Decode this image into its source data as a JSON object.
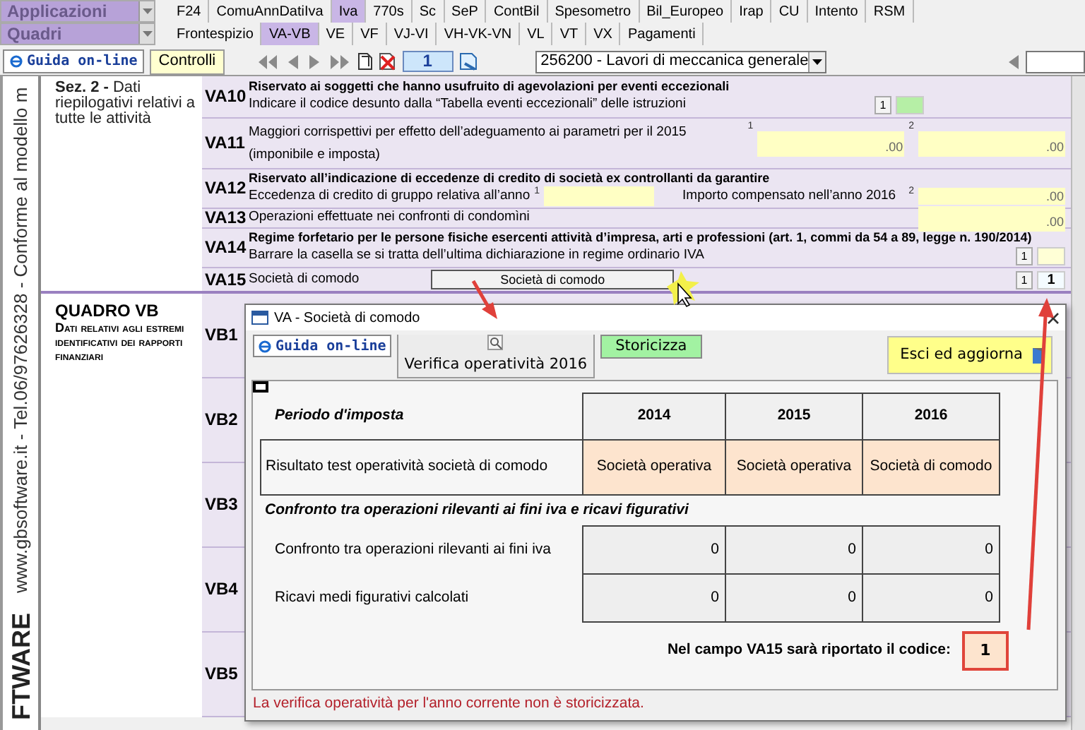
{
  "menus": [
    {
      "label": "Applicazioni",
      "tabs": [
        {
          "label": "F24",
          "selected": false
        },
        {
          "label": "ComuAnnDatiIva",
          "selected": false
        },
        {
          "label": "Iva",
          "selected": true
        },
        {
          "label": "770s",
          "selected": false
        },
        {
          "label": "Sc",
          "selected": false
        },
        {
          "label": "SeP",
          "selected": false
        },
        {
          "label": "ContBil",
          "selected": false
        },
        {
          "label": "Spesometro",
          "selected": false
        },
        {
          "label": "Bil_Europeo",
          "selected": false
        },
        {
          "label": "Irap",
          "selected": false
        },
        {
          "label": "CU",
          "selected": false
        },
        {
          "label": "Intento",
          "selected": false
        },
        {
          "label": "RSM",
          "selected": false
        }
      ]
    },
    {
      "label": "Quadri",
      "tabs": [
        {
          "label": "Frontespizio",
          "selected": false
        },
        {
          "label": "VA-VB",
          "selected": true
        },
        {
          "label": "VE",
          "selected": false
        },
        {
          "label": "VF",
          "selected": false
        },
        {
          "label": "VJ-VI",
          "selected": false
        },
        {
          "label": "VH-VK-VN",
          "selected": false
        },
        {
          "label": "VL",
          "selected": false
        },
        {
          "label": "VT",
          "selected": false
        },
        {
          "label": "VX",
          "selected": false
        },
        {
          "label": "Pagamenti",
          "selected": false
        }
      ]
    }
  ],
  "toolbar": {
    "help_button": "Guida on-line",
    "controls_button": "Controlli",
    "page": "1",
    "activity": "256200 - Lavori di meccanica generale"
  },
  "side_strip": {
    "brand": "FTWARE",
    "text": "www.gbsoftware.it - Tel.06/97626328 - Conforme al modello m"
  },
  "sections": [
    {
      "title": "**Sez. 2 -** Dati riepilogativi relativi a tutte le attività",
      "rows": [
        {
          "code": "VA10",
          "heading": "Riservato ai soggetti che hanno usufruito di agevolazioni per eventi eccezionali",
          "label": "Indicare il codice desunto dalla “Tabella eventi eccezionali” delle istruzioni",
          "fields": [
            {
              "kind": "flag",
              "index": "1"
            }
          ]
        },
        {
          "code": "VA11",
          "label": "Maggiori corrispettivi per effetto dell’adeguamento ai parametri per il 2015",
          "label_2": "(imponibile e imposta)",
          "fields": [
            {
              "kind": "amount",
              "index": "1",
              "value": ".00"
            },
            {
              "kind": "amount",
              "index": "2",
              "value": ".00"
            }
          ]
        },
        {
          "code": "VA12",
          "heading": "Riservato all’indicazione di eccedenze di credito di società ex controllanti da garantire",
          "label": "Eccedenza di credito di gruppo relativa all’anno",
          "fields": [
            {
              "kind": "year",
              "index": "1"
            },
            {
              "kind": "amount",
              "index": "2",
              "label": "Importo compensato nell’anno 2016",
              "value": ".00"
            }
          ]
        },
        {
          "code": "VA13",
          "label": "Operazioni effettuate nei confronti di condomìni",
          "fields": [
            {
              "kind": "amount",
              "value": ".00"
            }
          ]
        },
        {
          "code": "VA14",
          "heading": "Regime forfetario per le persone fisiche esercenti attività d’impresa, arti e professioni (art. 1, commi da 54 a 89, legge n. 190/2014)",
          "label": "Barrare la casella se si tratta dell’ultima dichiarazione in regime ordinario IVA",
          "fields": [
            {
              "kind": "check",
              "index": "1"
            }
          ]
        },
        {
          "code": "VA15",
          "label": "Società di comodo",
          "fields": [
            {
              "kind": "button",
              "value": "Società di comodo"
            },
            {
              "kind": "code",
              "index": "1",
              "value": "1"
            }
          ]
        }
      ]
    },
    {
      "title": "QUADRO VB",
      "subtitle": "Dati relativi agli estremi identificativi dei rapporti finanziari",
      "rows": [
        {
          "code": "VB1"
        },
        {
          "code": "VB2"
        },
        {
          "code": "VB3"
        },
        {
          "code": "VB4"
        },
        {
          "code": "VB5"
        }
      ]
    }
  ],
  "dialog": {
    "title": "VA - Società di comodo",
    "help_button": "Guida on-line",
    "verify_button": "Verifica operatività 2016",
    "archive_button": "Storicizza",
    "exit_button": "Esci ed aggiorna",
    "period_label": "Periodo d'imposta",
    "years": [
      "2014",
      "2015",
      "2016"
    ],
    "result_label": "Risultato test operatività società di comodo",
    "results": [
      "Società operativa",
      "Società operativa",
      "Società di comodo"
    ],
    "comparison_title": "Confronto tra operazioni rilevanti ai fini iva e ricavi figurativi",
    "comparison_rows": [
      {
        "label": "Confronto tra operazioni rilevanti ai fini iva",
        "values": [
          "0",
          "0",
          "0"
        ]
      },
      {
        "label": "Ricavi medi figurativi calcolati",
        "values": [
          "0",
          "0",
          "0"
        ]
      }
    ],
    "code_label": "Nel campo VA15 sarà riportato il codice:",
    "code": "1",
    "footer": "La verifica operatività per l'anno corrente non è storicizzata."
  }
}
